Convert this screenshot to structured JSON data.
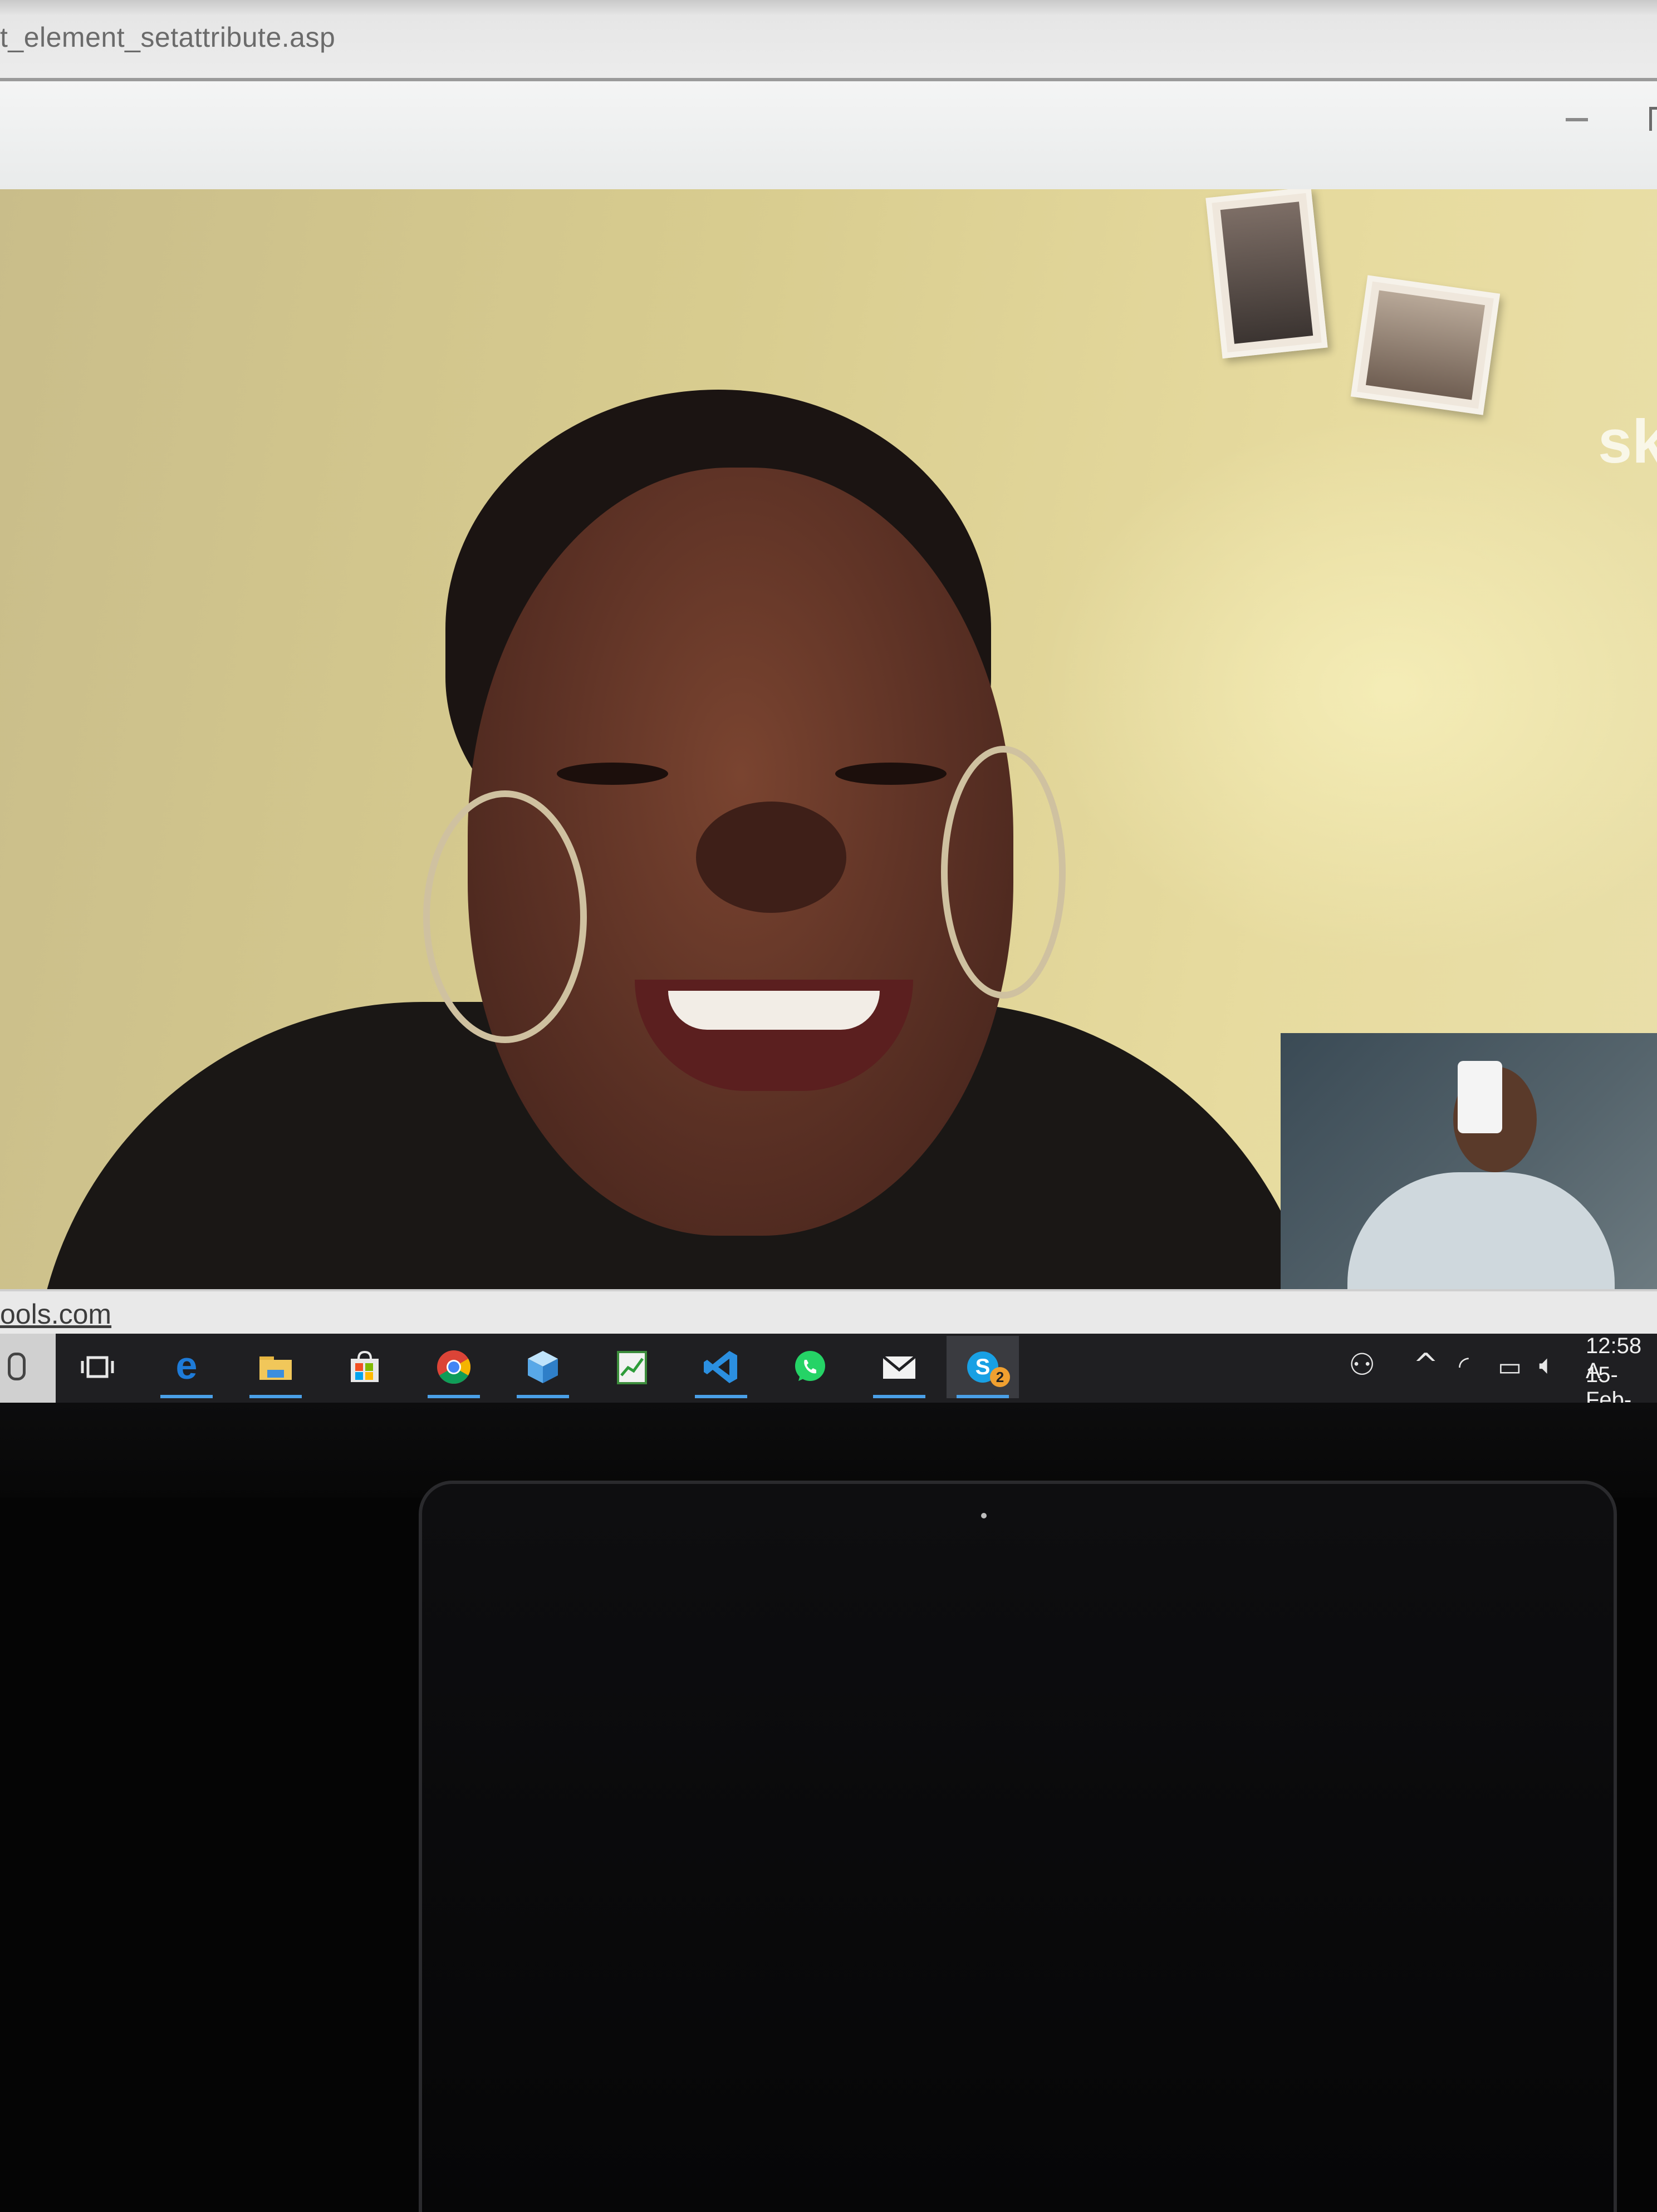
{
  "browser": {
    "url_fragment": "t_element_setattribute.asp",
    "status_link": "ools.com"
  },
  "skype": {
    "watermark": "sk",
    "unread_badge": "2"
  },
  "taskbar": {
    "apps": [
      {
        "name": "Task View",
        "icon": "task-view-icon"
      },
      {
        "name": "Microsoft Edge",
        "icon": "edge-icon"
      },
      {
        "name": "File Explorer",
        "icon": "folder-icon"
      },
      {
        "name": "Microsoft Store",
        "icon": "store-icon"
      },
      {
        "name": "Google Chrome",
        "icon": "chrome-icon"
      },
      {
        "name": "3D Viewer",
        "icon": "cube-icon"
      },
      {
        "name": "Chart app",
        "icon": "chart-icon"
      },
      {
        "name": "Visual Studio Code",
        "icon": "vscode-icon"
      },
      {
        "name": "WhatsApp",
        "icon": "whatsapp-icon"
      },
      {
        "name": "Mail",
        "icon": "mail-icon"
      },
      {
        "name": "Skype",
        "icon": "skype-icon"
      }
    ],
    "clock_time": "12:58 A",
    "clock_date": "15-Feb-"
  },
  "colors": {
    "taskbar_bg": "#1f1f22",
    "accent_underline": "#4aa0e8",
    "edge_blue": "#1e7bd8",
    "skype_blue": "#18a0e4",
    "whatsapp_green": "#25d366"
  }
}
